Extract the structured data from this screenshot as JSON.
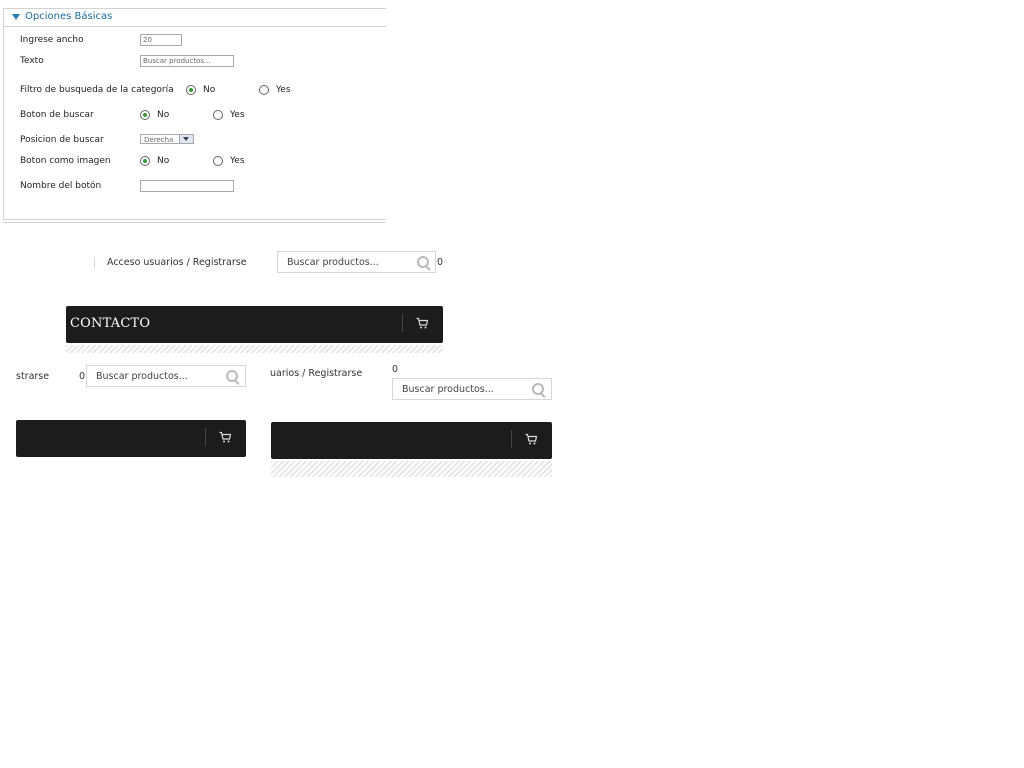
{
  "panel": {
    "title": "Opciones Básicas",
    "fields": {
      "width_label": "Ingrese ancho",
      "width_value": "20",
      "text_label": "Texto",
      "text_placeholder": "Buscar productos...",
      "category_filter_label": "Filtro de busqueda de la categoría",
      "search_button_label": "Boton de buscar",
      "search_position_label": "Posicion de buscar",
      "search_position_value": "Derecha",
      "button_image_label": "Boton como imagen",
      "button_name_label": "Nombre del botón",
      "button_name_value": "",
      "no": "No",
      "yes": "Yes",
      "category_filter_selected": "No",
      "search_button_selected": "No",
      "button_image_selected": "No"
    }
  },
  "preview1": {
    "login_text": "Acceso usuarios / Registrarse",
    "search_placeholder": "Buscar productos...",
    "cart_count": "0",
    "nav_title": "CONTACTO"
  },
  "preview2": {
    "login_text": "strarse",
    "cart_count": "0",
    "search_placeholder": "Buscar productos..."
  },
  "preview3": {
    "login_text": "uarios / Registrarse",
    "cart_count": "0",
    "search_placeholder": "Buscar productos..."
  },
  "icons": {
    "collapse": "triangle-down-icon",
    "search": "magnifier-icon",
    "cart": "shopping-cart-icon"
  },
  "colors": {
    "accent": "#1e6a98",
    "radio_selected": "#3a9a3a",
    "bar": "#1c1c1c"
  }
}
